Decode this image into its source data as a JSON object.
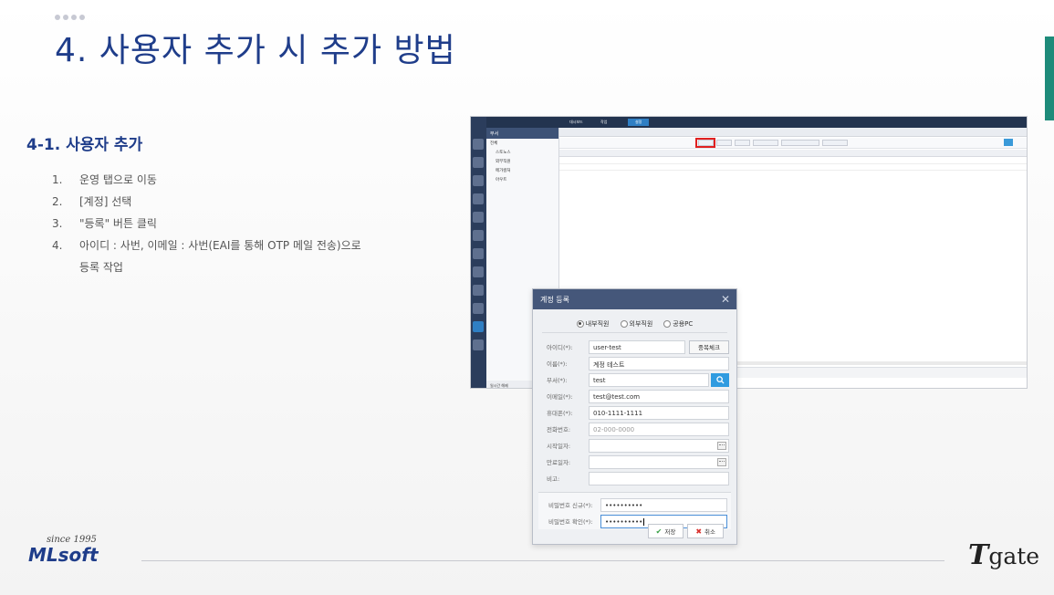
{
  "slide": {
    "title": "4.  사용자 추가 시 추가 방법",
    "section": "4-1. 사용자 추가",
    "steps": [
      {
        "n": "1.",
        "text": "운영 탭으로 이동"
      },
      {
        "n": "2.",
        "text": "[계정] 선택"
      },
      {
        "n": "3.",
        "text": "\"등록\" 버튼 클릭"
      },
      {
        "n": "4.",
        "text": "아이디 :  사번, 이메일 : 사번(EAI를 통해 OTP 메일 전송)으로"
      }
    ],
    "step4_cont": "등록 작업"
  },
  "app": {
    "tree_header": "부서",
    "tree_items": [
      "전체",
      "스토노스",
      "외부직원",
      "메가컬처",
      "아우트"
    ],
    "ribbon_tabs": [
      "대시보드",
      "작업",
      "설정"
    ],
    "status_left": "일시간 해제",
    "colors": {
      "highlight": "#e02020",
      "sidebar": "#2b3d5c"
    }
  },
  "dialog": {
    "title": "계정 등록",
    "close_icon": "close-icon",
    "radio_options": [
      {
        "label": "내부직원",
        "checked": true
      },
      {
        "label": "외부직원",
        "checked": false
      },
      {
        "label": "공용PC",
        "checked": false
      }
    ],
    "fields": {
      "id": {
        "label": "아이디(*):",
        "value": "user-test"
      },
      "dup_check": "중복체크",
      "name": {
        "label": "이름(*):",
        "value": "계정 테스트"
      },
      "dept": {
        "label": "부서(*):",
        "value": "test"
      },
      "email": {
        "label": "이메일(*):",
        "value": "test@test.com"
      },
      "mobile": {
        "label": "휴대폰(*):",
        "value": "010-1111-1111"
      },
      "phone": {
        "label": "전화번호:",
        "placeholder": "02-000-0000"
      },
      "start": {
        "label": "시작일자:",
        "value": ""
      },
      "end": {
        "label": "만료일자:",
        "value": ""
      },
      "note": {
        "label": "비고:",
        "value": ""
      },
      "pw_new": {
        "label": "비밀번호 신규(*):",
        "value": "••••••••••"
      },
      "pw_confirm": {
        "label": "비밀번호 확인(*):",
        "value": "••••••••••"
      }
    },
    "save_label": "저장",
    "cancel_label": "취소"
  },
  "footer": {
    "ml_since": "since 1995",
    "ml_brand": "MLsoft",
    "tgate_T": "T",
    "tgate_rest": "gate"
  }
}
